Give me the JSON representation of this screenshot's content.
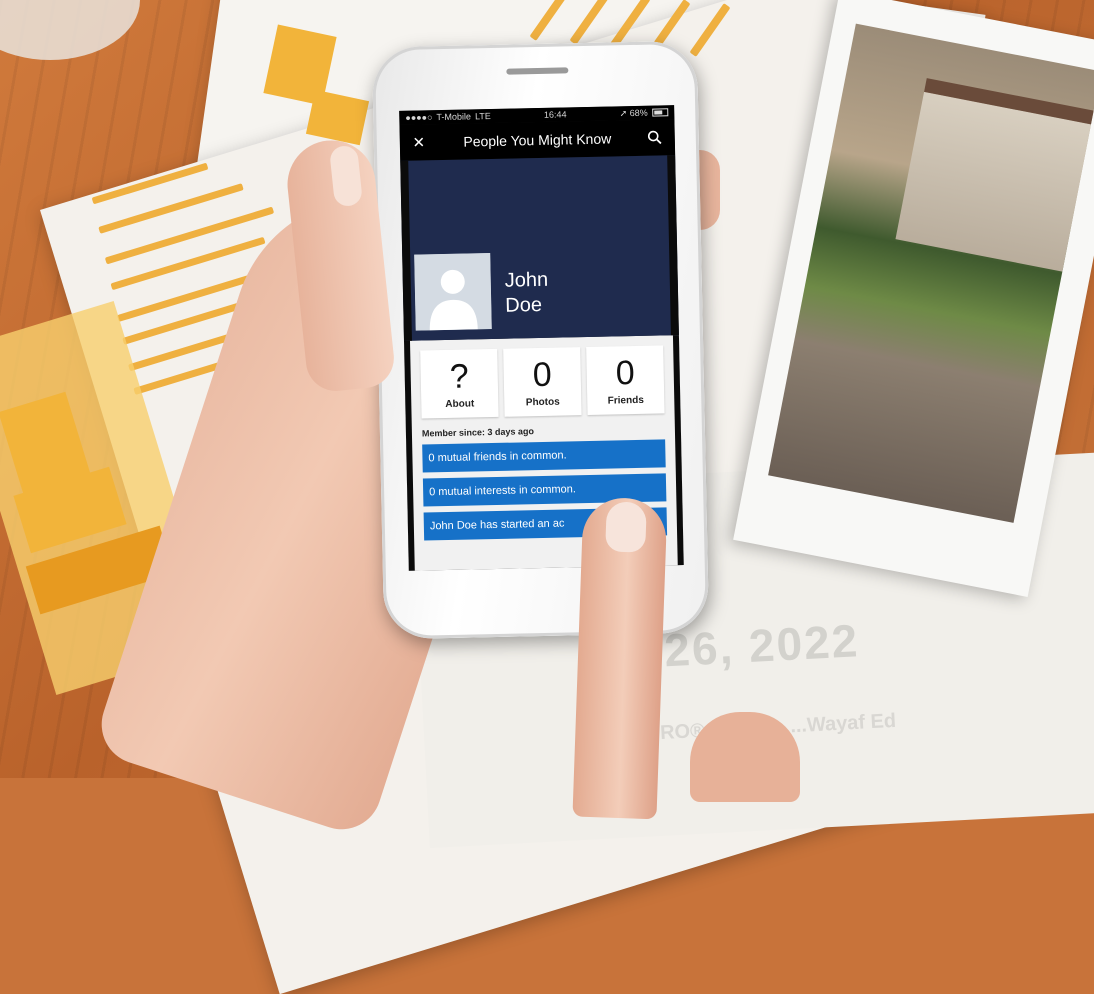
{
  "status_bar": {
    "carrier": "T-Mobile",
    "network": "LTE",
    "time": "16:44",
    "battery": "68%"
  },
  "header": {
    "title": "People You Might Know",
    "close_icon": "close-icon",
    "search_icon": "search-icon"
  },
  "profile": {
    "first_name": "John",
    "last_name": "Doe"
  },
  "stats": [
    {
      "value": "?",
      "label": "About"
    },
    {
      "value": "0",
      "label": "Photos"
    },
    {
      "value": "0",
      "label": "Friends"
    }
  ],
  "member_since": "Member since: 3 days ago",
  "info_items": [
    "0 mutual friends in common.",
    "0 mutual interests in common.",
    "John Doe has started an ac"
  ],
  "background": {
    "big_text": "ril 26, 2022",
    "small_text": "RO® Certifi... ...Wayaf Ed"
  },
  "colors": {
    "accent_blue": "#1671c8",
    "banner_navy": "#1f2b4e",
    "chart_orange": "#f2b43a"
  }
}
